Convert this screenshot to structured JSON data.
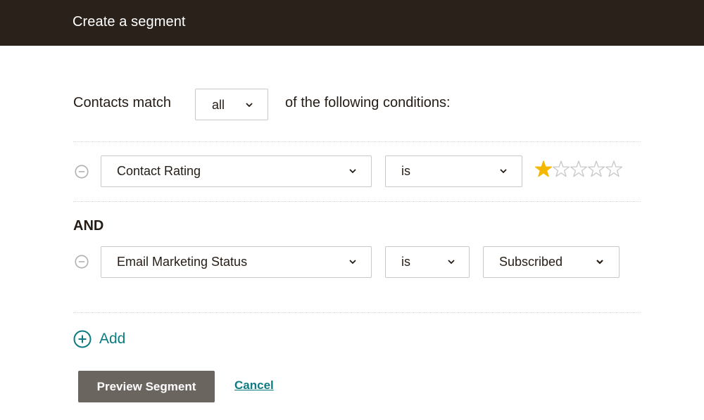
{
  "header": {
    "title": "Create a segment"
  },
  "match": {
    "prefix": "Contacts match",
    "selected": "all",
    "suffix": "of the following conditions:"
  },
  "conditions": [
    {
      "field": "Contact Rating",
      "operator": "is",
      "rating": {
        "value": 1,
        "max": 5
      }
    },
    {
      "conjunction": "AND",
      "field": "Email Marketing Status",
      "operator": "is",
      "value": "Subscribed"
    }
  ],
  "actions": {
    "add_label": "Add",
    "preview_label": "Preview Segment",
    "cancel_label": "Cancel"
  },
  "colors": {
    "header_bg": "#2b211b",
    "accent_teal": "#0d7b81",
    "star_filled": "#f5b800",
    "button_bg": "#6b6560"
  },
  "icons": {
    "chevron": "chevron-down-icon",
    "remove": "minus-circle-icon",
    "add": "plus-circle-icon",
    "star": "star-icon"
  }
}
